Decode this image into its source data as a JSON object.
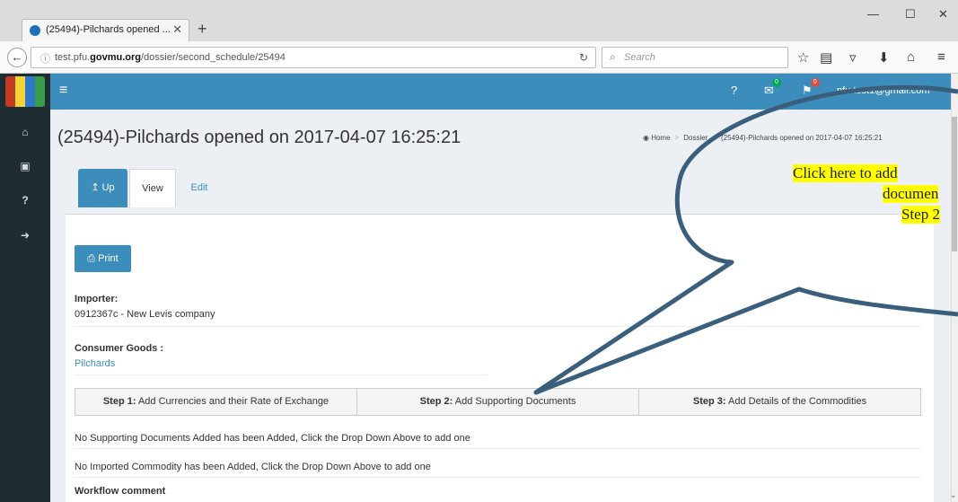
{
  "browser": {
    "tab_title": "(25494)-Pilchards opened ...",
    "tab_close": "✕",
    "new_tab": "+",
    "url_prefix": "test.pfu.",
    "url_domain": "govmu.org",
    "url_path": "/dossier/second_schedule/25494",
    "search_placeholder": "Search",
    "minimize": "—",
    "maximize": "☐",
    "close": "✕"
  },
  "header": {
    "user_email": "pfu.test1@gmail.com",
    "messages_count": "0",
    "flags_count": "0"
  },
  "page": {
    "title": "(25494)-Pilchards opened on 2017-04-07 16:25:21",
    "breadcrumb": {
      "home": "Home",
      "dossier": "Dossier",
      "current": "(25494)-Pilchards opened on 2017-04-07 16:25:21"
    }
  },
  "tabs": {
    "up": "Up",
    "view": "View",
    "edit": "Edit"
  },
  "content": {
    "print_label": "Print",
    "importer_label": "Importer:",
    "importer_value": "0912367c - New Levis company",
    "consumer_label": "Consumer Goods :",
    "consumer_value": "Pilchards",
    "steps": [
      {
        "prefix": "Step 1:",
        "label": " Add Currencies and their Rate of Exchange"
      },
      {
        "prefix": "Step 2:",
        "label": " Add Supporting Documents"
      },
      {
        "prefix": "Step 3:",
        "label": " Add Details of the Commodities"
      }
    ],
    "no_documents_msg": "No Supporting Documents Added has been Added, Click the Drop Down Above to add one",
    "no_commodity_msg": "No Imported Commodity has been Added, Click the Drop Down Above to add one",
    "workflow_label": "Workflow comment"
  },
  "callout": {
    "line1": "Click here to add",
    "line2": "documen",
    "line3": "Step 2"
  },
  "colors": {
    "primary": "#3c8dbc",
    "sidebar": "#1f2d33",
    "callout_stroke": "#3a5f7d",
    "highlight": "#ffff00"
  }
}
